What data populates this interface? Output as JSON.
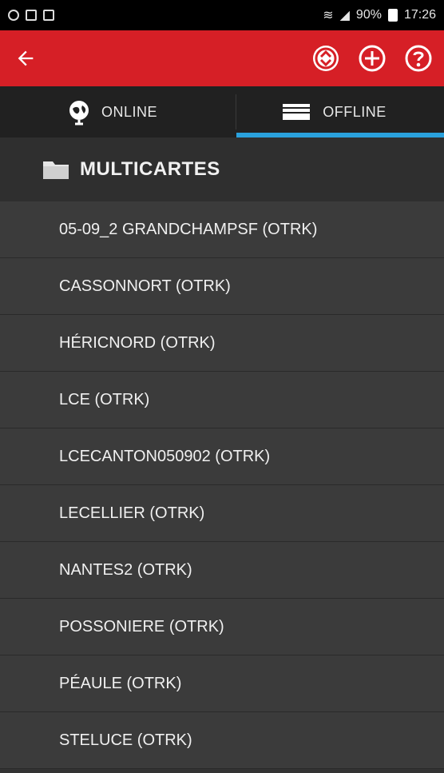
{
  "status_bar": {
    "battery": "90%",
    "time": "17:26"
  },
  "toolbar": {
    "back_icon": "back-arrow-icon",
    "actions": [
      "sync-icon",
      "add-icon",
      "help-icon"
    ],
    "color": "#d61f26"
  },
  "tabs": [
    {
      "label": "ONLINE",
      "icon": "globe-icon",
      "selected": false
    },
    {
      "label": "OFFLINE",
      "icon": "storage-icon",
      "selected": true
    }
  ],
  "folder": {
    "label": "MULTICARTES",
    "icon": "folder-icon"
  },
  "items": [
    {
      "label": "05-09_2 GRANDCHAMPSF (OTRK)"
    },
    {
      "label": "CASSONNORT (OTRK)"
    },
    {
      "label": "HÉRICNORD (OTRK)"
    },
    {
      "label": "LCE (OTRK)"
    },
    {
      "label": "LCECANTON050902 (OTRK)"
    },
    {
      "label": "LECELLIER (OTRK)"
    },
    {
      "label": "NANTES2 (OTRK)"
    },
    {
      "label": "POSSONIERE (OTRK)"
    },
    {
      "label": "PÉAULE (OTRK)"
    },
    {
      "label": "STELUCE (OTRK)"
    }
  ],
  "colors": {
    "accent": "#2aa1dd",
    "toolbar": "#d61f26",
    "background": "#333333"
  }
}
